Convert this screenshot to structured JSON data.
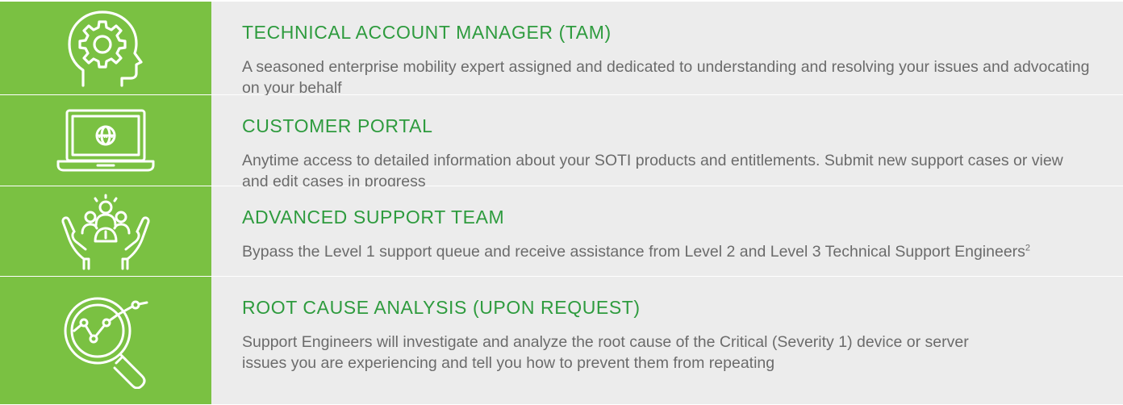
{
  "colors": {
    "green": "#7ac142",
    "title_green": "#2e9b3e",
    "text_gray": "#6b6b6b",
    "row_bg": "#ececec"
  },
  "rows": [
    {
      "icon": "head-gear-icon",
      "title": "TECHNICAL ACCOUNT MANAGER (TAM)",
      "desc": "A seasoned enterprise mobility expert assigned and dedicated to understanding and resolving your issues and advocating on your behalf"
    },
    {
      "icon": "laptop-www-icon",
      "title": "CUSTOMER PORTAL",
      "desc": "Anytime access to detailed information about your SOTI products and entitlements. Submit new support cases or view and edit cases in progress"
    },
    {
      "icon": "hands-team-icon",
      "title": "ADVANCED SUPPORT TEAM",
      "desc": "Bypass the Level 1 support queue and receive assistance from Level 2 and Level 3 Technical Support Engineers",
      "footnote": "2"
    },
    {
      "icon": "magnifier-chart-icon",
      "title": "ROOT CAUSE ANALYSIS (UPON REQUEST)",
      "desc": "Support Engineers will investigate and analyze the root cause of the Critical (Severity 1) device or server issues you are experiencing and tell you how to prevent them from repeating"
    }
  ]
}
